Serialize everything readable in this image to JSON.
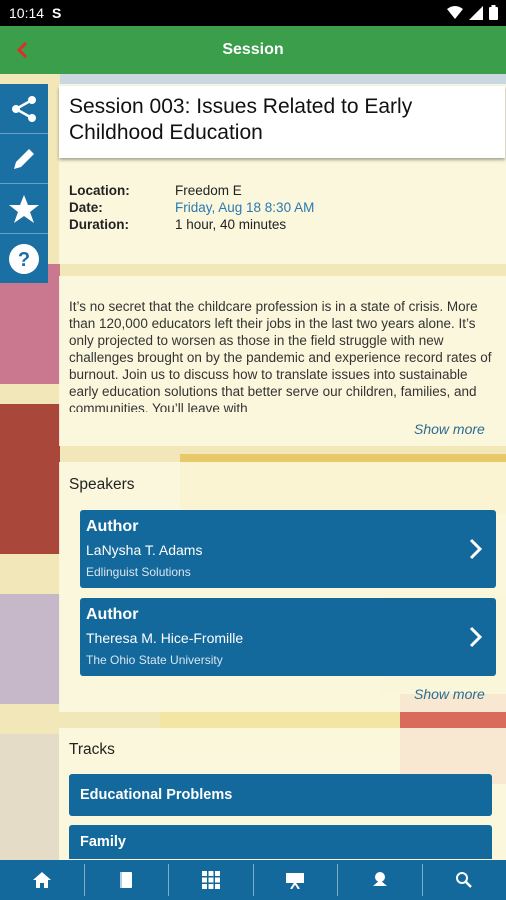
{
  "status_bar": {
    "time": "10:14",
    "carrier_icon": "S"
  },
  "appbar": {
    "title": "Session",
    "back_icon": "chevron-left-icon"
  },
  "sidebar": {
    "items": [
      "share-icon",
      "pencil-icon",
      "star-icon",
      "help-icon"
    ]
  },
  "session": {
    "title": "Session 003: Issues Related to Early Childhood Education",
    "location_label": "Location:",
    "location": "Freedom E",
    "date_label": "Date:",
    "date": "Friday, Aug 18 8:30 AM",
    "duration_label": "Duration:",
    "duration": "1 hour, 40 minutes",
    "description": "It’s no secret that the childcare profession is in a state of crisis. More than 120,000 educators left their jobs in the last two years alone. It’s only projected to worsen as those in the field struggle with new challenges brought on by the pandemic and experience record rates of burnout. Join us to discuss how to translate issues into sustainable early education solutions that better serve our children, families, and communities. You’ll leave with",
    "show_more": "Show more"
  },
  "speakers": {
    "heading": "Speakers",
    "items": [
      {
        "role": "Author",
        "name": "LaNysha T. Adams",
        "org": "Edlinguist Solutions"
      },
      {
        "role": "Author",
        "name": "Theresa M. Hice-Fromille",
        "org": "The Ohio State University"
      }
    ],
    "show_more": "Show more"
  },
  "tracks": {
    "heading": "Tracks",
    "items": [
      "Educational Problems",
      "Family"
    ]
  },
  "bottom_nav": [
    "home-icon",
    "book-icon",
    "grid-icon",
    "presentation-icon",
    "map-pin-icon",
    "search-icon"
  ],
  "colors": {
    "appbar": "#3a9e4a",
    "primary": "#13689c",
    "link": "#2d6c8f",
    "date": "#2a7ab0"
  }
}
